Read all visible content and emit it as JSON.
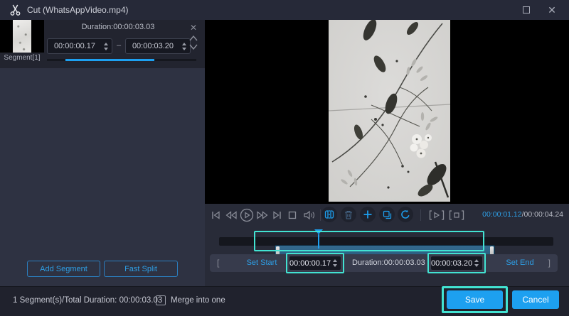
{
  "window": {
    "title": "Cut (WhatsAppVideo.mp4)",
    "icons": [
      "scissors-icon",
      "maximize-icon",
      "close-icon"
    ]
  },
  "segment_panel": {
    "segment_label": "Segment[1]",
    "duration_label": "Duration:00:00:03.03",
    "start_value": "00:00:00.17",
    "range_dash": "–",
    "end_value": "00:00:03.20",
    "icons": [
      "remove-segment-icon",
      "move-up-icon",
      "move-down-icon"
    ],
    "progress_color": "#1da0f0",
    "add_segment_label": "Add Segment",
    "fast_split_label": "Fast Split"
  },
  "player": {
    "transport_icons": [
      "skip-start-icon",
      "rewind-icon",
      "play-icon",
      "forward-icon",
      "skip-end-icon",
      "stop-icon",
      "volume-icon"
    ],
    "edit_icons": [
      "split-icon",
      "delete-icon",
      "add-icon",
      "copy-icon",
      "reset-icon"
    ],
    "segment_preview_icons": [
      "play-segment-icon",
      "stop-segment-icon"
    ],
    "current_time": "00:00:01.12",
    "time_separator": "/",
    "total_time": "00:00:04.24"
  },
  "trim_bar": {
    "open_bracket": "[",
    "set_start_label": "Set Start",
    "start_value": "00:00:00.17",
    "duration_label": "Duration:00:00:03.03",
    "end_value": "00:00:03.20",
    "set_end_label": "Set End",
    "close_bracket": "]"
  },
  "footer": {
    "summary": "1 Segment(s)/Total Duration: 00:00:03.03",
    "merge_label": "Merge into one",
    "merge_checked": false,
    "save_label": "Save",
    "cancel_label": "Cancel"
  },
  "colors": {
    "accent_blue": "#1da0f0",
    "link_blue": "#2e9fe6",
    "highlight_cyan": "#42e3d2",
    "titlebar": "#262938",
    "panel": "#2e3242",
    "controls_bg": "#282b38",
    "footer_bg": "#20222d"
  }
}
